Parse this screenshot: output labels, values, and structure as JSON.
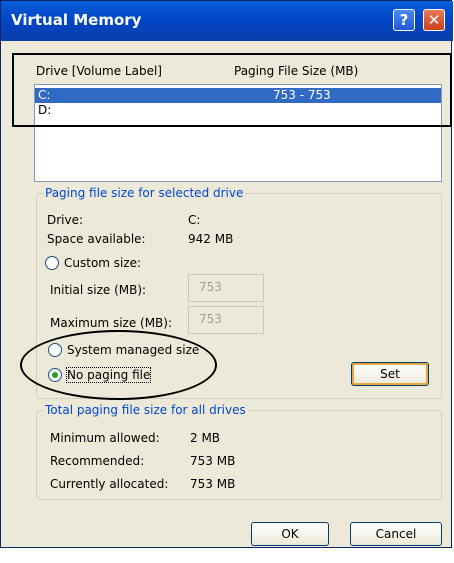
{
  "window": {
    "title": "Virtual Memory"
  },
  "titlebar_buttons": {
    "help": "?",
    "close": "✕"
  },
  "list": {
    "headers": {
      "drive": "Drive  [Volume Label]",
      "size": "Paging File Size (MB)"
    },
    "rows": [
      {
        "drive": "C:",
        "size": "753 - 753",
        "selected": true
      },
      {
        "drive": "D:",
        "size": "",
        "selected": false
      }
    ]
  },
  "selected_drive_group": {
    "label": "Paging file size for selected drive",
    "drive_label": "Drive:",
    "drive_value": "C:",
    "space_label": "Space available:",
    "space_value": "942 MB",
    "custom_size": "Custom size:",
    "initial_label": "Initial size (MB):",
    "initial_value": "753",
    "maximum_label": "Maximum size (MB):",
    "maximum_value": "753",
    "system_managed": "System managed size",
    "no_paging": "No paging file",
    "set_button": "Set"
  },
  "total_group": {
    "label": "Total paging file size for all drives",
    "min_label": "Minimum allowed:",
    "min_value": "2 MB",
    "rec_label": "Recommended:",
    "rec_value": "753 MB",
    "cur_label": "Currently allocated:",
    "cur_value": "753 MB"
  },
  "buttons": {
    "ok": "OK",
    "cancel": "Cancel"
  },
  "colors": {
    "title_bar": "#0a5fd8",
    "selection": "#316ac5",
    "group_label": "#0046d5",
    "radio_selected": "#21a121"
  }
}
